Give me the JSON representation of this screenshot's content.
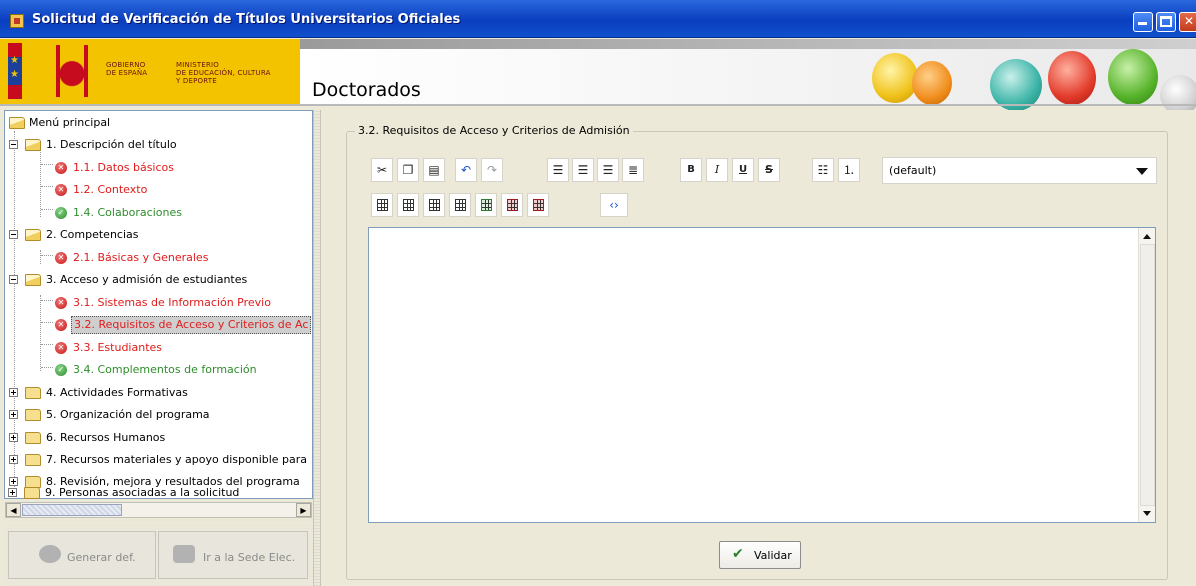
{
  "window": {
    "title": "Solicitud de Verificación de Títulos Universitarios Oficiales"
  },
  "header": {
    "gov_line1": "GOBIERNO",
    "gov_line2": "DE ESPAÑA",
    "ministry_line1": "MINISTERIO",
    "ministry_line2": "DE EDUCACIÓN, CULTURA",
    "ministry_line3": "Y DEPORTE",
    "section": "Doctorados"
  },
  "tree": {
    "root": "Menú principal",
    "items": [
      {
        "label": "1. Descripción del título",
        "status": "none"
      },
      {
        "label": "1.1. Datos básicos",
        "status": "error"
      },
      {
        "label": "1.2. Contexto",
        "status": "error"
      },
      {
        "label": "1.4. Colaboraciones",
        "status": "ok"
      },
      {
        "label": "2. Competencias",
        "status": "none"
      },
      {
        "label": "2.1. Básicas y Generales",
        "status": "error"
      },
      {
        "label": "3. Acceso y admisión de estudiantes",
        "status": "none"
      },
      {
        "label": "3.1. Sistemas de Información Previo",
        "status": "error"
      },
      {
        "label": "3.2. Requisitos de Acceso y Criterios de Ac",
        "status": "error",
        "selected": true
      },
      {
        "label": "3.3. Estudiantes",
        "status": "error"
      },
      {
        "label": "3.4. Complementos de formación",
        "status": "ok"
      },
      {
        "label": "4. Actividades Formativas",
        "status": "none"
      },
      {
        "label": "5. Organización del programa",
        "status": "none"
      },
      {
        "label": "6. Recursos Humanos",
        "status": "none"
      },
      {
        "label": "7. Recursos materiales y apoyo disponible para",
        "status": "none"
      },
      {
        "label": "8. Revisión, mejora y resultados del programa",
        "status": "none"
      },
      {
        "label": "9. Personas asociadas a la solicitud",
        "status": "none"
      }
    ]
  },
  "buttons": {
    "generate": "Generar def.",
    "sede": "Ir a la Sede Elec.",
    "validate": "Validar"
  },
  "form": {
    "group_title": "3.2. Requisitos de Acceso y Criterios de Admisión",
    "font_select_value": "(default)",
    "editor_content": ""
  },
  "colors": {
    "error": "#e01b1b",
    "ok": "#2f8d2b",
    "titlebar": "#0a3fbf"
  }
}
